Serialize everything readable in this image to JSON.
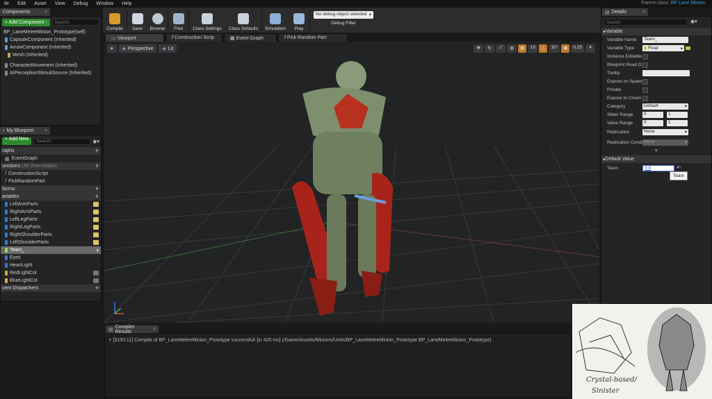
{
  "menu": [
    "ile",
    "Edit",
    "Asset",
    "View",
    "Debug",
    "Window",
    "Help"
  ],
  "parent_class": {
    "label": "Parent class:",
    "value": "BP Lane Minion"
  },
  "components": {
    "tab": "Components",
    "add_button": "+ Add Component -",
    "search_placeholder": "Search",
    "self": "BP_LaneMeleeMinion_Prototype(self)",
    "items": [
      "CapsuleComponent (Inherited)",
      "ArrowComponent (Inherited)",
      "Mesh (Inherited)",
      "CharacterMovement (Inherited)",
      "AIPerceptionStimuliSource (Inherited)"
    ]
  },
  "toolbar": {
    "buttons": [
      "Compile",
      "Save",
      "Browse",
      "Find",
      "Class Settings",
      "Class Defaults",
      "Simulation",
      "Play"
    ],
    "debug_select": "No debug object selected",
    "debug_label": "Debug Filter"
  },
  "tabs": [
    "Viewport",
    "Construction Scrip",
    "Event Graph",
    "Pick Random Part"
  ],
  "viewport": {
    "perspective": "Perspective",
    "lit": "Lit",
    "tools": [
      "10",
      "10°",
      "0.25",
      "4"
    ]
  },
  "my_blueprint": {
    "tab": "My Blueprint",
    "add_new": "+ Add New -",
    "search_placeholder": "Search",
    "graphs_header": "raphs",
    "graphs": [
      "EventGraph"
    ],
    "functions_header": "unctions",
    "functions_note": "(49 Overridable)",
    "functions": [
      "ConstructionScript",
      "PickRandomPart"
    ],
    "macros_header": "lacros",
    "variables_header": "ariables",
    "variables": [
      "LeftArmParts",
      "RightArmParts",
      "LeftLegParts",
      "RightLegParts",
      "RightShoulderParts",
      "LeftShoulderParts",
      "Team_",
      "Eyes",
      "HeartLight",
      "RedLightCol",
      "BlueLightCol"
    ],
    "dispatchers_header": "vent Dispatchers"
  },
  "details": {
    "tab": "Details",
    "search_placeholder": "Search",
    "variable_header": "Variable",
    "rows": [
      {
        "label": "Variable Name",
        "value": "Team_"
      },
      {
        "label": "Variable Type",
        "value": "Float"
      },
      {
        "label": "Instance Editable",
        "value": ""
      },
      {
        "label": "Blueprint Read O",
        "value": ""
      },
      {
        "label": "Tooltip",
        "value": ""
      },
      {
        "label": "Expose on Spawn",
        "value": ""
      },
      {
        "label": "Private",
        "value": ""
      },
      {
        "label": "Expose to Cinem",
        "value": ""
      },
      {
        "label": "Category",
        "value": "Default"
      },
      {
        "label": "Slider Range",
        "value": "0",
        "value2": "1"
      },
      {
        "label": "Value Range",
        "value": "0",
        "value2": "1"
      },
      {
        "label": "Replication",
        "value": "None"
      },
      {
        "label": "Replication Condi",
        "value": "None"
      }
    ],
    "default_header": "Default Value",
    "team_label": "Team",
    "team_value": "0.0",
    "tooltip": "Team"
  },
  "compiler": {
    "tab": "Compiler Results",
    "message": "[3150.11] Compile of BP_LaneMeleeMinion_Prototype successful! [in 420 ms] (/Game/Assets/Minions/Units/BP_LaneMeleeMinion_Prototype.BP_LaneMeleeMinion_Prototype)"
  },
  "sketch": {
    "caption1": "Crystal-based/",
    "caption2": "Sinister"
  }
}
